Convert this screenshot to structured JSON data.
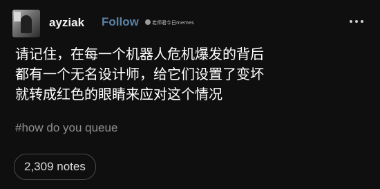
{
  "post": {
    "username": "ayziak",
    "follow_label": "Follow",
    "watermark": "老师君今日memes",
    "text_lines": [
      "请记住，在每一个机器人危机爆发的背后",
      "都有一个无名设计师，给它们设置了变坏",
      "就转成红色的眼睛来应对这个情况"
    ],
    "tag": "#how do you queue",
    "notes": "2,309 notes"
  },
  "icons": {
    "more": "more-horizontal-icon",
    "avatar": "avatar"
  },
  "colors": {
    "background": "#0f0f0f",
    "follow": "#5b84a8",
    "tag": "#8e8e8e"
  }
}
